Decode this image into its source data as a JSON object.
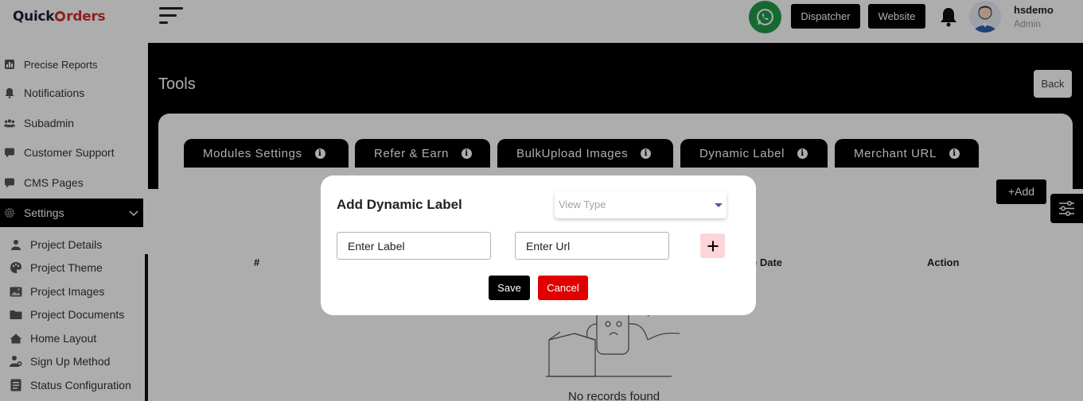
{
  "header": {
    "logo_prefix": "Quick",
    "logo_suffix": "rders",
    "dispatcher_label": "Dispatcher",
    "website_label": "Website",
    "user_name": "hsdemo",
    "user_role": "Admin"
  },
  "sidebar": {
    "items": [
      {
        "label": "Precise Reports",
        "icon": "chart-icon"
      },
      {
        "label": "Notifications",
        "icon": "bell-icon"
      },
      {
        "label": "Subadmin",
        "icon": "users-icon"
      },
      {
        "label": "Customer Support",
        "icon": "chat-icon"
      },
      {
        "label": "CMS Pages",
        "icon": "chat-icon"
      },
      {
        "label": "Settings",
        "icon": "gear-icon"
      }
    ],
    "subitems": [
      {
        "label": "Project Details",
        "icon": "user-icon"
      },
      {
        "label": "Project Theme",
        "icon": "palette-icon"
      },
      {
        "label": "Project Images",
        "icon": "image-icon"
      },
      {
        "label": "Project Documents",
        "icon": "folder-icon"
      },
      {
        "label": "Home Layout",
        "icon": "home-icon"
      },
      {
        "label": "Sign Up Method",
        "icon": "user-plus-icon"
      },
      {
        "label": "Status Configuration",
        "icon": "list-icon"
      }
    ]
  },
  "main": {
    "title": "Tools",
    "back_label": "Back",
    "tabs": [
      {
        "label": "Modules Settings"
      },
      {
        "label": "Refer & Earn"
      },
      {
        "label": "BulkUpload Images"
      },
      {
        "label": "Dynamic Label"
      },
      {
        "label": "Merchant URL"
      }
    ],
    "add_label": "+Add",
    "table_headers": [
      "#",
      "e Date",
      "Action"
    ],
    "empty_text": "No records found"
  },
  "modal": {
    "title": "Add Dynamic Label",
    "view_type_placeholder": "View Type",
    "label_placeholder": "Enter Label",
    "url_placeholder": "Enter Url",
    "save_label": "Save",
    "cancel_label": "Cancel"
  },
  "colors": {
    "accent": "#000000",
    "brand_red": "#d32f2f",
    "cancel_red": "#e00000",
    "plus_bg": "#fcd5d9",
    "whatsapp": "#1e9d4a"
  }
}
